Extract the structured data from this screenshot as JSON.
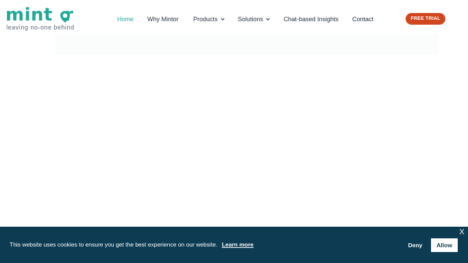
{
  "brand": {
    "logo_text": "mint",
    "logo_text_end": "r",
    "tagline": "leaving no-one behind",
    "accent_color": "#22a898"
  },
  "nav": {
    "items": [
      {
        "label": "Home",
        "active": true,
        "has_dropdown": false
      },
      {
        "label": "Why Mintor",
        "active": false,
        "has_dropdown": false
      },
      {
        "label": "Products",
        "active": false,
        "has_dropdown": true,
        "icon": "chevron-down-icon"
      },
      {
        "label": "Solutions",
        "active": false,
        "has_dropdown": true,
        "icon": "chevron-down-icon"
      },
      {
        "label": "Chat-based Insights",
        "active": false,
        "has_dropdown": false
      },
      {
        "label": "Contact",
        "active": false,
        "has_dropdown": false
      }
    ],
    "cta_label": "FREE TRIAL",
    "cta_color": "#d0461e"
  },
  "cookie_banner": {
    "message": "This website uses cookies to ensure you get the best experience on our website.",
    "learn_more_label": "Learn more",
    "deny_label": "Deny",
    "allow_label": "Allow",
    "close_label": "X",
    "background_color": "#0c3b52"
  }
}
